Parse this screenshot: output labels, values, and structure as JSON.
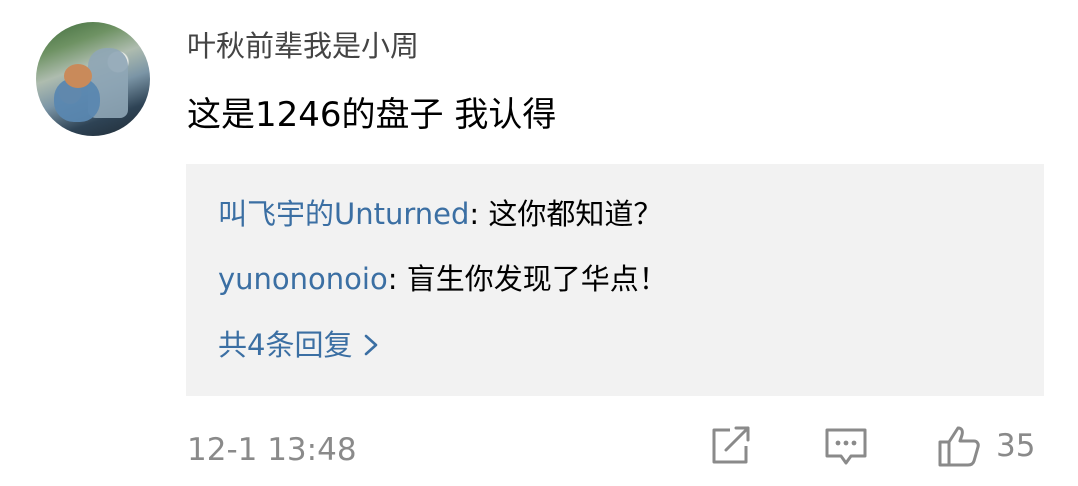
{
  "comment": {
    "username": "叶秋前辈我是小周",
    "text": "这是1246的盘子 我认得",
    "timestamp": "12-1 13:48",
    "likes": "35"
  },
  "replies": [
    {
      "user": "叫飞宇的Unturned",
      "separator": ": ",
      "text": "这你都知道？"
    },
    {
      "user": "yunononoio",
      "separator": ": ",
      "text": "盲生你发现了华点！"
    }
  ],
  "more_replies_label": "共4条回复",
  "icons": {
    "share": "share-icon",
    "comment": "comment-icon",
    "like": "thumbs-up-icon",
    "more": "chevron-right-icon"
  },
  "colors": {
    "link_blue": "#3b6fa3",
    "meta_gray": "#8a8a8a",
    "reply_bg": "#f2f2f2"
  }
}
